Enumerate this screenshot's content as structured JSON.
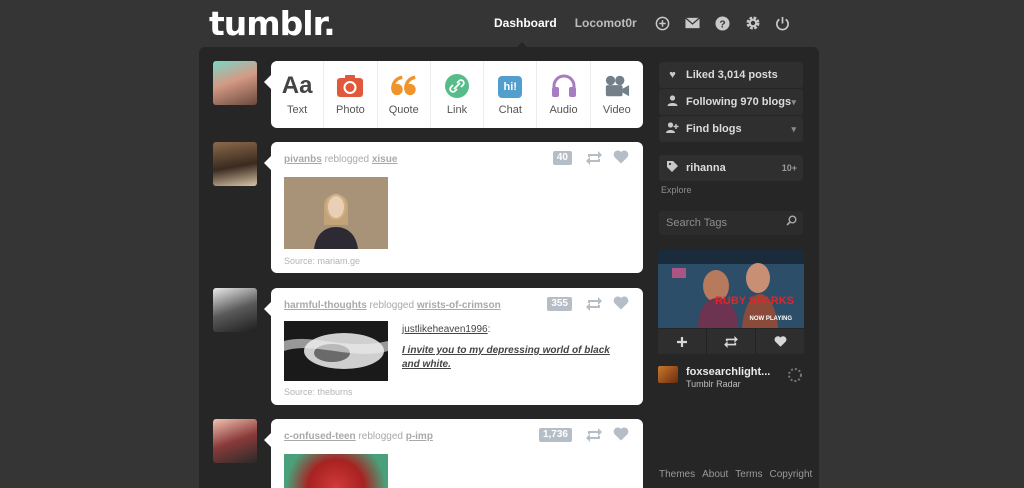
{
  "header": {
    "logo": "tumblr.",
    "nav": {
      "dashboard": "Dashboard",
      "blog": "Locomot0r"
    },
    "icons": [
      "plus-icon",
      "mail-icon",
      "help-icon",
      "gear-icon",
      "power-icon"
    ]
  },
  "post_types": [
    {
      "label": "Text",
      "glyph": "Aa",
      "color": "#444444"
    },
    {
      "label": "Photo",
      "glyph": "",
      "color": "#e1593b"
    },
    {
      "label": "Quote",
      "glyph": "66",
      "color": "#f1932c"
    },
    {
      "label": "Link",
      "glyph": "",
      "color": "#56bc8a"
    },
    {
      "label": "Chat",
      "glyph": "hi!",
      "color": "#529ecc"
    },
    {
      "label": "Audio",
      "glyph": "",
      "color": "#a77dc2"
    },
    {
      "label": "Video",
      "glyph": "",
      "color": "#748089"
    }
  ],
  "posts": [
    {
      "user": "pivanbs",
      "action": "reblogged",
      "from": "xisue",
      "count": "40",
      "source": "Source: mariam.ge"
    },
    {
      "user": "harmful-thoughts",
      "action": "reblogged",
      "from": "wrists-of-crimson",
      "count": "355",
      "quote_user": "justlikeheaven1996",
      "quote_text": "I invite you to my depressing world of black and white.",
      "source": "Source: theburns"
    },
    {
      "user": "c-onfused-teen",
      "action": "reblogged",
      "from": "p-imp",
      "count": "1,736"
    }
  ],
  "sidebar": {
    "liked": "Liked 3,014 posts",
    "following": "Following 970 blogs",
    "find": "Find blogs",
    "tag": "rihanna",
    "tag_badge": "10+",
    "explore": "Explore",
    "search_placeholder": "Search Tags",
    "radar_overlay": "RUBY SPARKS",
    "radar_overlay_sub": "NOW PLAYING",
    "radar_title": "foxsearchlight...",
    "radar_sub": "Tumblr Radar",
    "footer": [
      "Themes",
      "About",
      "Terms",
      "Copyright"
    ]
  }
}
